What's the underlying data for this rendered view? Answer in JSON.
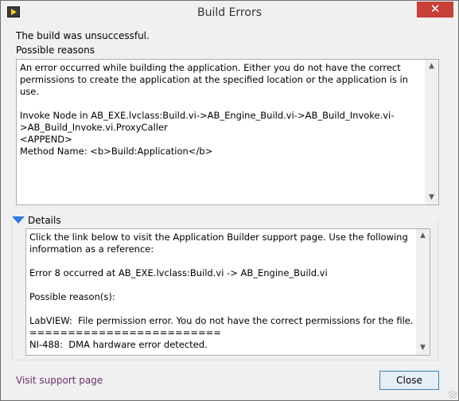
{
  "window": {
    "title": "Build Errors",
    "close_glyph": "✕",
    "app_icon": "labview-icon"
  },
  "summary": {
    "status_text": "The build was unsuccessful.",
    "reasons_label": "Possible reasons",
    "reasons_text": "An error occurred while building the application. Either you do not have the correct permissions to create the application at the specified location or the application is in use.\n\nInvoke Node in AB_EXE.lvclass:Build.vi->AB_Engine_Build.vi->AB_Build_Invoke.vi->AB_Build_Invoke.vi.ProxyCaller\n<APPEND>\nMethod Name: <b>Build:Application</b>"
  },
  "details": {
    "label": "Details",
    "text": "Click the link below to visit the Application Builder support page. Use the following information as a reference:\n\nError 8 occurred at AB_EXE.lvclass:Build.vi -> AB_Engine_Build.vi\n\nPossible reason(s):\n\nLabVIEW:  File permission error. You do not have the correct permissions for the file.\n=========================\nNI-488:  DMA hardware error detected."
  },
  "footer": {
    "support_link": "Visit support page",
    "close_button": "Close"
  },
  "scroll": {
    "up_glyph": "▲",
    "down_glyph": "▼"
  }
}
